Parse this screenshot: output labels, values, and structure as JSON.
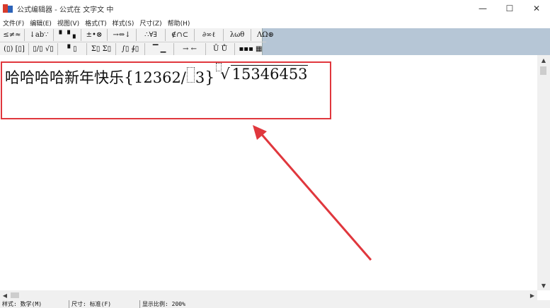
{
  "window": {
    "title": "公式编辑器 - 公式在 文字文 中",
    "controls": {
      "minimize": "—",
      "maximize": "☐",
      "close": "✕"
    }
  },
  "menu": [
    "文件(F)",
    "编辑(E)",
    "视图(V)",
    "格式(T)",
    "样式(S)",
    "尺寸(Z)",
    "帮助(H)"
  ],
  "toolbar": {
    "row1": [
      "≤≠≈",
      "↓ab∵",
      "▘▝▗",
      "±•⊗",
      "→⇔↓",
      "∴∀∃",
      "∉∩⊂",
      "∂∞ℓ",
      "λωθ",
      "ΛΩ⊛"
    ],
    "row2": [
      "(▯) [▯]",
      "▯/▯ √▯",
      "▘▯",
      "Σ▯ Σ▯",
      "∫▯ ∮▯",
      "▔ ▁",
      "→ ←",
      "Ū Ů",
      "▪▪▪ ▦"
    ]
  },
  "equation": {
    "text": "哈哈哈哈新年快乐",
    "brace_open": "{",
    "numerator": "12362/",
    "after_placeholder": "3",
    "brace_close": "}",
    "radicand": "15346453"
  },
  "scrollbars": {
    "up": "▲",
    "down": "▼",
    "left": "◀",
    "right": "▶"
  },
  "status": {
    "style": "样式: 数学(M)",
    "size": "尺寸: 标准(F)",
    "zoom": "显示比例: 200%"
  },
  "colors": {
    "annotation": "#e0373d",
    "toolbar_bg": "#b6c6d6"
  }
}
